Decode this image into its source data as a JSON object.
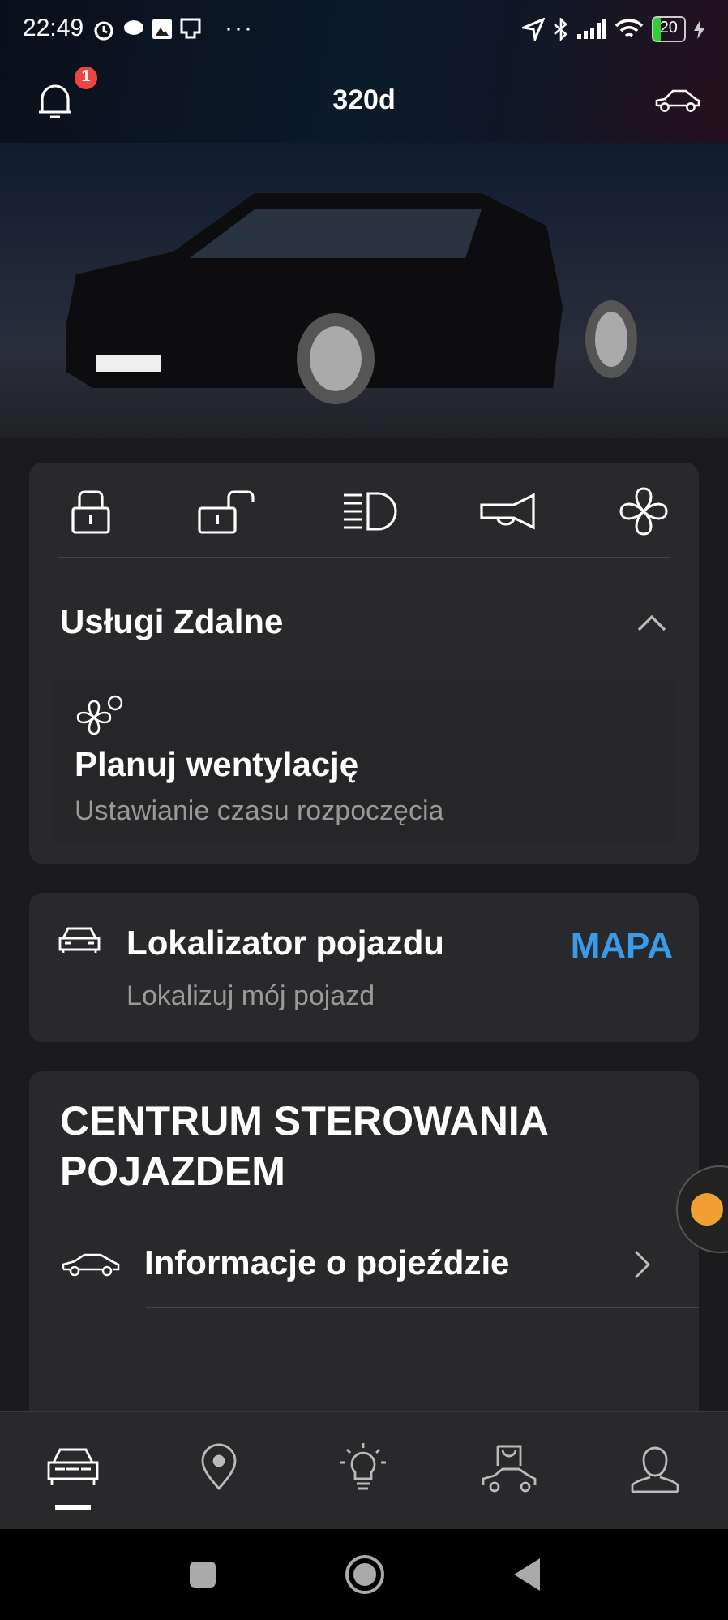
{
  "status_bar": {
    "time": "22:49",
    "more": "···",
    "battery": "20"
  },
  "header": {
    "title": "320d",
    "notification_count": "1"
  },
  "quick_actions": [
    {
      "kind": "lock"
    },
    {
      "kind": "unlock"
    },
    {
      "kind": "light"
    },
    {
      "kind": "horn"
    },
    {
      "kind": "fan"
    }
  ],
  "remote_services": {
    "title": "Usługi Zdalne",
    "expanded": true,
    "items": [
      {
        "title": "Planuj wentylację",
        "subtitle": "Ustawianie czasu rozpoczęcia"
      }
    ]
  },
  "locator": {
    "title": "Lokalizator pojazdu",
    "subtitle": "Lokalizuj mój pojazd",
    "action": "MAPA"
  },
  "control_center": {
    "title": "CENTRUM STEROWANIA POJAZDEM",
    "items": [
      {
        "title": "Informacje o pojeździe"
      }
    ]
  },
  "bottom_nav": [
    {
      "kind": "car",
      "selected": true
    },
    {
      "kind": "pin",
      "selected": false
    },
    {
      "kind": "bulb",
      "selected": false
    },
    {
      "kind": "shop",
      "selected": false
    },
    {
      "kind": "profile",
      "selected": false
    }
  ]
}
